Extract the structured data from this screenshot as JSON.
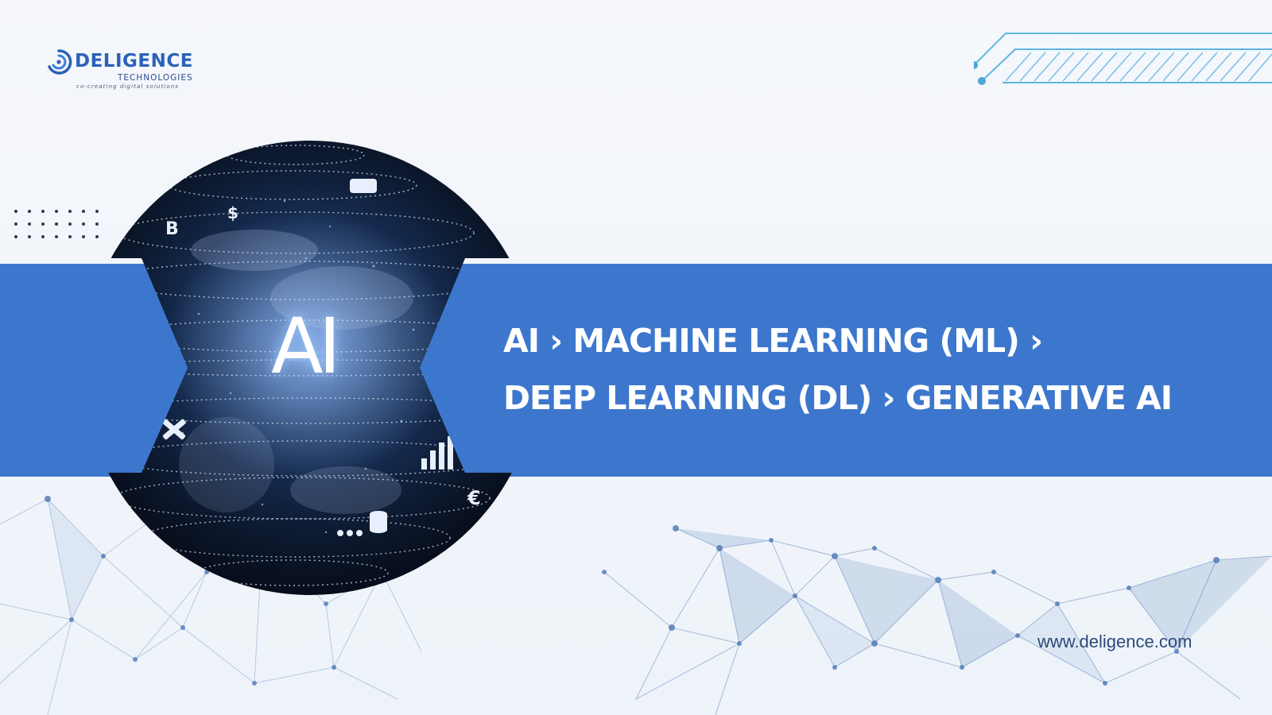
{
  "logo": {
    "name": "DELIGENCE",
    "subtitle": "TECHNOLOGIES",
    "tagline": "co-creating digital solutions"
  },
  "globe": {
    "label": "AI",
    "icon_names": [
      "bitcoin-icon",
      "money-bag-icon",
      "car-charging-icon",
      "tools-icon",
      "bar-chart-icon",
      "database-icon",
      "euro-icon",
      "people-icon"
    ]
  },
  "headline": {
    "line1": "AI › MACHINE LEARNING (ML) ›",
    "line2": "DEEP LEARNING (DL) › GENERATIVE AI"
  },
  "footer": {
    "website": "www.deligence.com"
  },
  "colors": {
    "banner": "#3d77cd",
    "brand": "#2a62b8",
    "globe_dark": "#0b1526",
    "network": "#5c86c0"
  }
}
